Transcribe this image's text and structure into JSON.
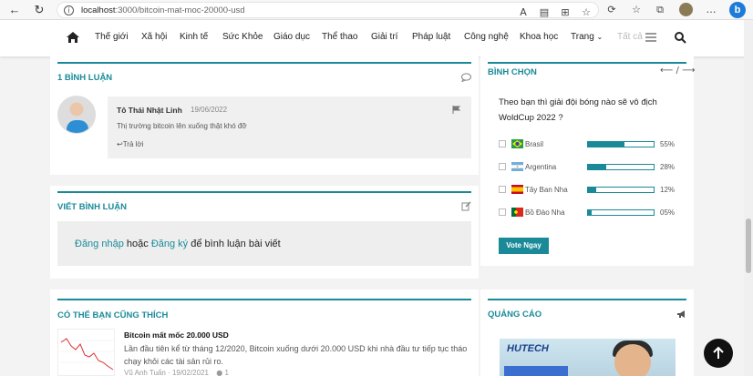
{
  "browser": {
    "url_host": "localhost",
    "url_path": ":3000/bitcoin-mat-moc-20000-usd",
    "bing_label": "b"
  },
  "nav": {
    "items": [
      "Thế giới",
      "Xã hội",
      "Kinh tế",
      "Sức Khỏe",
      "Giáo dục",
      "Thể thao",
      "Giải trí",
      "Pháp luật",
      "Công nghệ",
      "Khoa học",
      "Trang",
      "Tất cả"
    ]
  },
  "comments": {
    "title": "1 BÌNH LUẬN",
    "items": [
      {
        "author": "Tô Thái Nhật Linh",
        "date": "19/06/2022",
        "text": "Thị trường bitcoin lên xuống thật khó đỡ",
        "reply_label": "Trả lời"
      }
    ]
  },
  "write_comment": {
    "title": "VIẾT BÌNH LUẬN",
    "login_label": "Đăng nhập",
    "or_label": "hoặc",
    "register_label": "Đăng ký",
    "suffix": "để bình luận bài viết"
  },
  "poll": {
    "title": "BÌNH CHỌN",
    "pager": "/",
    "question": "Theo bạn thì giải đội bóng nào sẽ vô địch WoldCup 2022 ?",
    "options": [
      {
        "name": "Brasil",
        "percent_label": "55%",
        "percent": 55
      },
      {
        "name": "Argentina",
        "percent_label": "28%",
        "percent": 28
      },
      {
        "name": "Tây Ban Nha",
        "percent_label": "12%",
        "percent": 12
      },
      {
        "name": "Bồ Đào Nha",
        "percent_label": "05%",
        "percent": 5
      }
    ],
    "vote_label": "Vote Ngay"
  },
  "related": {
    "title": "CÓ THỂ BẠN CŨNG THÍCH",
    "items": [
      {
        "title": "Bitcoin mất mốc 20.000 USD",
        "desc": "Lần đầu tiên kể từ tháng 12/2020, Bitcoin xuống dưới 20.000 USD khi nhà đầu tư tiếp tục tháo chạy khỏi các tài sản rủi ro.",
        "author": "Vũ Anh Tuấn",
        "date": "19/02/2021",
        "comments": "1"
      }
    ]
  },
  "ads": {
    "title": "QUẢNG CÁO",
    "logo_text": "HUTECH"
  }
}
